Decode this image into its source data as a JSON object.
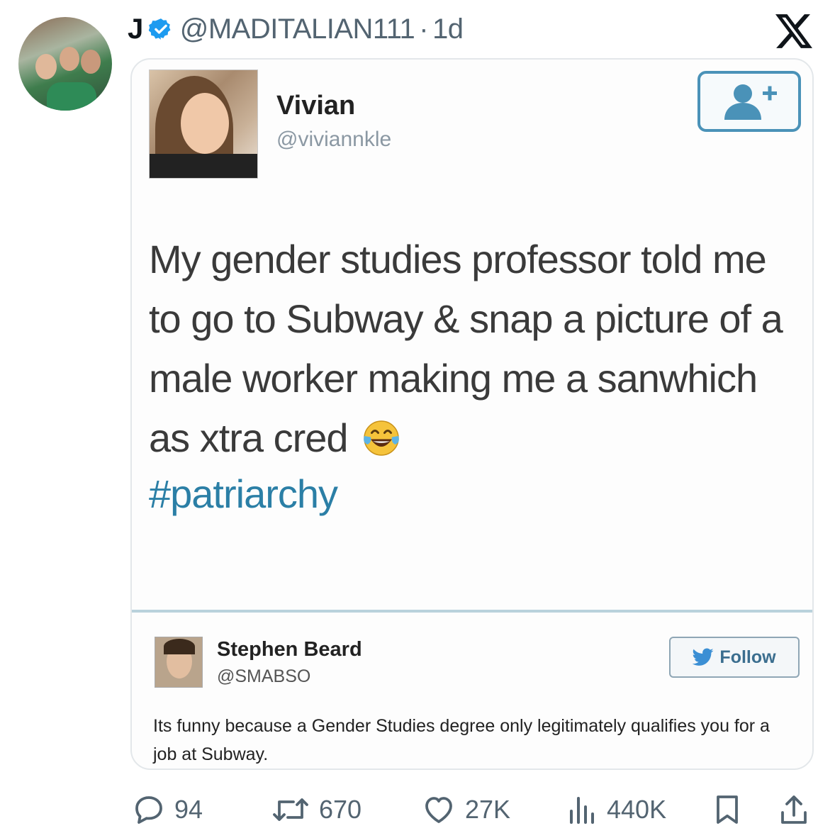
{
  "post": {
    "author_name": "J",
    "author_handle": "@MADITALIAN111",
    "separator": "·",
    "time": "1d"
  },
  "embedded_tweet": {
    "name": "Vivian",
    "handle": "@viviannkle",
    "text": "My gender studies professor told me to go to Subway & snap a picture of a male worker making me a sanwhich as xtra cred",
    "emoji": "face-with-tears-of-joy",
    "hashtag": "#patriarchy"
  },
  "reply": {
    "name": "Stephen Beard",
    "handle": "@SMABSO",
    "follow_label": "Follow",
    "text": "Its funny because a Gender Studies degree only legitimately qualifies you for a job at Subway."
  },
  "actions": {
    "replies": "94",
    "reposts": "670",
    "likes": "27K",
    "views": "440K"
  },
  "colors": {
    "verified": "#1d9bf0",
    "muted": "#536471",
    "hashtag": "#2b7fa6",
    "add_button_border": "#4a92b8"
  }
}
